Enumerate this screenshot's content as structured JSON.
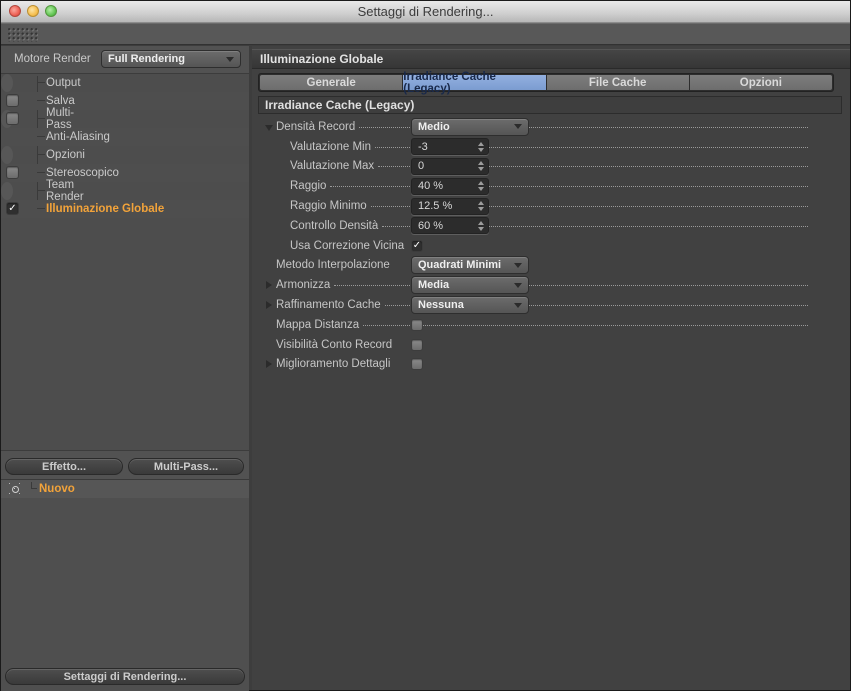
{
  "window": {
    "title": "Settaggi di Rendering...",
    "traffic_lights": [
      "close",
      "minimize",
      "zoom"
    ]
  },
  "left_panel": {
    "engine_label": "Motore Render",
    "engine_value": "Full Rendering",
    "tree_items": [
      {
        "label": "Output",
        "has_checkbox": false,
        "checked": false,
        "active": false
      },
      {
        "label": "Salva",
        "has_checkbox": true,
        "checked": false,
        "active": false
      },
      {
        "label": "Multi-Pass",
        "has_checkbox": true,
        "checked": false,
        "active": false
      },
      {
        "label": "Anti-Aliasing",
        "has_checkbox": false,
        "checked": false,
        "active": false
      },
      {
        "label": "Opzioni",
        "has_checkbox": false,
        "checked": false,
        "active": false
      },
      {
        "label": "Stereoscopico",
        "has_checkbox": true,
        "checked": false,
        "active": false
      },
      {
        "label": "Team Render",
        "has_checkbox": false,
        "checked": false,
        "active": false
      },
      {
        "label": "Illuminazione Globale",
        "has_checkbox": true,
        "checked": true,
        "active": true
      }
    ],
    "effect_button": "Effetto...",
    "multipass_button": "Multi-Pass...",
    "new_effect_item": "Nuovo",
    "settings_button": "Settaggi di Rendering..."
  },
  "main_panel": {
    "header": "Illuminazione Globale",
    "tabs": [
      {
        "label": "Generale",
        "active": false
      },
      {
        "label": "Irradiance Cache (Legacy)",
        "active": true
      },
      {
        "label": "File Cache",
        "active": false
      },
      {
        "label": "Opzioni",
        "active": false
      }
    ],
    "section_header": "Irradiance Cache (Legacy)",
    "fields": [
      {
        "label": "Densità Record",
        "type": "dropdown",
        "value": "Medio",
        "marker": "expanded",
        "indent": 0,
        "dots": true
      },
      {
        "label": "Valutazione Min",
        "type": "stepper",
        "value": "-3",
        "marker": "none",
        "indent": 1,
        "dots": true
      },
      {
        "label": "Valutazione Max",
        "type": "stepper",
        "value": "0",
        "marker": "none",
        "indent": 1,
        "dots": true
      },
      {
        "label": "Raggio",
        "type": "stepper",
        "value": "40 %",
        "marker": "none",
        "indent": 1,
        "dots": true
      },
      {
        "label": "Raggio Minimo",
        "type": "stepper",
        "value": "12.5 %",
        "marker": "none",
        "indent": 1,
        "dots": true
      },
      {
        "label": "Controllo Densità",
        "type": "stepper",
        "value": "60 %",
        "marker": "none",
        "indent": 1,
        "dots": true
      },
      {
        "label": "Usa Correzione Vicina",
        "type": "checkbox",
        "checked": true,
        "marker": "none",
        "indent": 1,
        "dots": false
      },
      {
        "label": "Metodo Interpolazione",
        "type": "dropdown",
        "value": "Quadrati Minimi",
        "marker": "none",
        "indent": 0,
        "dots": false
      },
      {
        "label": "Armonizza",
        "type": "dropdown",
        "value": "Media",
        "marker": "collapsed",
        "indent": 0,
        "dots": true
      },
      {
        "label": "Raffinamento Cache",
        "type": "dropdown",
        "value": "Nessuna",
        "marker": "collapsed",
        "indent": 0,
        "dots": true
      },
      {
        "label": "Mappa Distanza",
        "type": "checkbox",
        "checked": false,
        "marker": "none",
        "indent": 0,
        "dots": true
      },
      {
        "label": "Visibilità Conto Record",
        "type": "checkbox",
        "checked": false,
        "marker": "none",
        "indent": 0,
        "dots": false
      },
      {
        "label": "Miglioramento Dettagli",
        "type": "checkbox",
        "checked": false,
        "marker": "collapsed",
        "indent": 0,
        "dots": false
      }
    ]
  },
  "icons": {
    "checkmark": "✓",
    "grip": "grip-dots-icon",
    "effect": "render-effect-icon"
  },
  "colors": {
    "accent_orange": "#f2a33a",
    "tab_active": "#84a4d8",
    "panel_dark": "#414141",
    "panel_mid": "#525252",
    "field_dark": "#2c2c2c"
  }
}
